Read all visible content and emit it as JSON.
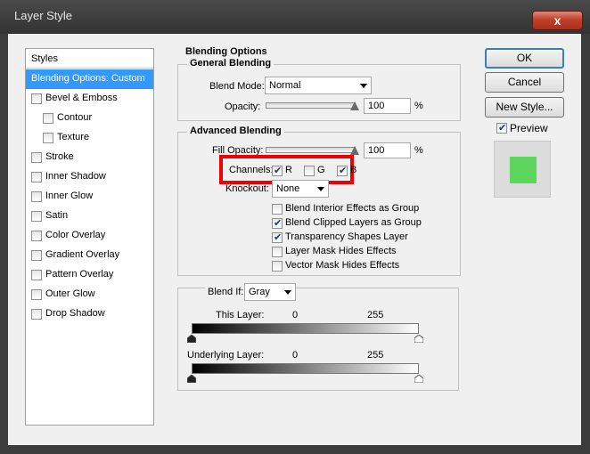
{
  "window": {
    "title": "Layer Style",
    "close_symbol": "x"
  },
  "styles": {
    "header": "Styles",
    "items": [
      {
        "label": "Blending Options: Custom",
        "checkbox": false,
        "checked": false,
        "selected": true
      },
      {
        "label": "Bevel & Emboss",
        "checkbox": true,
        "checked": false,
        "selected": false
      },
      {
        "label": "Contour",
        "checkbox": true,
        "checked": false,
        "selected": false,
        "indent": true
      },
      {
        "label": "Texture",
        "checkbox": true,
        "checked": false,
        "selected": false,
        "indent": true
      },
      {
        "label": "Stroke",
        "checkbox": true,
        "checked": false,
        "selected": false
      },
      {
        "label": "Inner Shadow",
        "checkbox": true,
        "checked": false,
        "selected": false
      },
      {
        "label": "Inner Glow",
        "checkbox": true,
        "checked": false,
        "selected": false
      },
      {
        "label": "Satin",
        "checkbox": true,
        "checked": false,
        "selected": false
      },
      {
        "label": "Color Overlay",
        "checkbox": true,
        "checked": false,
        "selected": false
      },
      {
        "label": "Gradient Overlay",
        "checkbox": true,
        "checked": false,
        "selected": false
      },
      {
        "label": "Pattern Overlay",
        "checkbox": true,
        "checked": false,
        "selected": false
      },
      {
        "label": "Outer Glow",
        "checkbox": true,
        "checked": false,
        "selected": false
      },
      {
        "label": "Drop Shadow",
        "checkbox": true,
        "checked": false,
        "selected": false
      }
    ]
  },
  "blending_options": {
    "title": "Blending Options",
    "general": {
      "title": "General Blending",
      "blend_mode_label": "Blend Mode:",
      "blend_mode_value": "Normal",
      "opacity_label": "Opacity:",
      "opacity_value": "100",
      "opacity_unit": "%",
      "opacity_level": 100
    },
    "advanced": {
      "title": "Advanced Blending",
      "fill_opacity_label": "Fill Opacity:",
      "fill_opacity_value": "100",
      "fill_opacity_unit": "%",
      "fill_opacity_level": 100,
      "channels_label": "Channels:",
      "channels": [
        {
          "label": "R",
          "checked": true
        },
        {
          "label": "G",
          "checked": false
        },
        {
          "label": "B",
          "checked": true
        }
      ],
      "knockout_label": "Knockout:",
      "knockout_value": "None",
      "options": [
        {
          "label": "Blend Interior Effects as Group",
          "checked": false
        },
        {
          "label": "Blend Clipped Layers as Group",
          "checked": true
        },
        {
          "label": "Transparency Shapes Layer",
          "checked": true
        },
        {
          "label": "Layer Mask Hides Effects",
          "checked": false
        },
        {
          "label": "Vector Mask Hides Effects",
          "checked": false
        }
      ]
    },
    "blend_if": {
      "label": "Blend If:",
      "value": "Gray",
      "this_layer_label": "This Layer:",
      "this_layer_min": "0",
      "this_layer_max": "255",
      "underlying_label": "Underlying Layer:",
      "underlying_min": "0",
      "underlying_max": "255"
    }
  },
  "buttons": {
    "ok": "OK",
    "cancel": "Cancel",
    "new_style": "New Style..."
  },
  "preview": {
    "label": "Preview",
    "checked": true,
    "swatch_color": "#5cd65c"
  },
  "colors": {
    "selection": "#3399ff",
    "highlight": "#ee0000",
    "title_bar": "#3c3c3c",
    "close_button": "#c0402a"
  }
}
